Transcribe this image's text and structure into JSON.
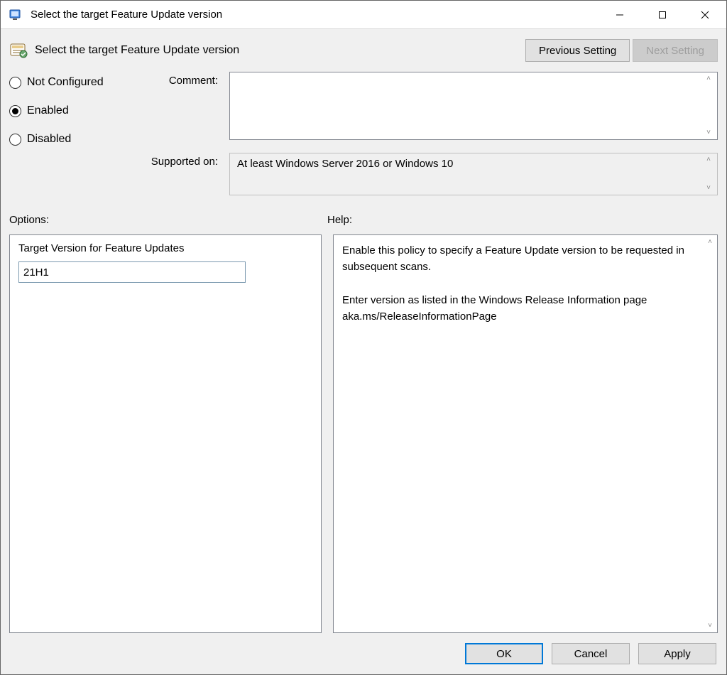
{
  "window": {
    "title": "Select the target Feature Update version"
  },
  "header": {
    "title": "Select the target Feature Update version",
    "prev_label": "Previous Setting",
    "next_label": "Next Setting",
    "next_enabled": false
  },
  "state": {
    "options": [
      {
        "id": "notconfigured",
        "label": "Not Configured",
        "selected": false
      },
      {
        "id": "enabled",
        "label": "Enabled",
        "selected": true
      },
      {
        "id": "disabled",
        "label": "Disabled",
        "selected": false
      }
    ],
    "comment_label": "Comment:",
    "comment_value": "",
    "supported_label": "Supported on:",
    "supported_value": "At least Windows Server 2016 or Windows 10"
  },
  "sections": {
    "options_label": "Options:",
    "help_label": "Help:"
  },
  "options_panel": {
    "field_label": "Target Version for Feature Updates",
    "field_value": "21H1"
  },
  "help_panel": {
    "text": "Enable this policy to specify a Feature Update version to be requested in subsequent scans.\n\nEnter version as listed in the Windows Release Information page aka.ms/ReleaseInformationPage"
  },
  "footer": {
    "ok": "OK",
    "cancel": "Cancel",
    "apply": "Apply"
  }
}
